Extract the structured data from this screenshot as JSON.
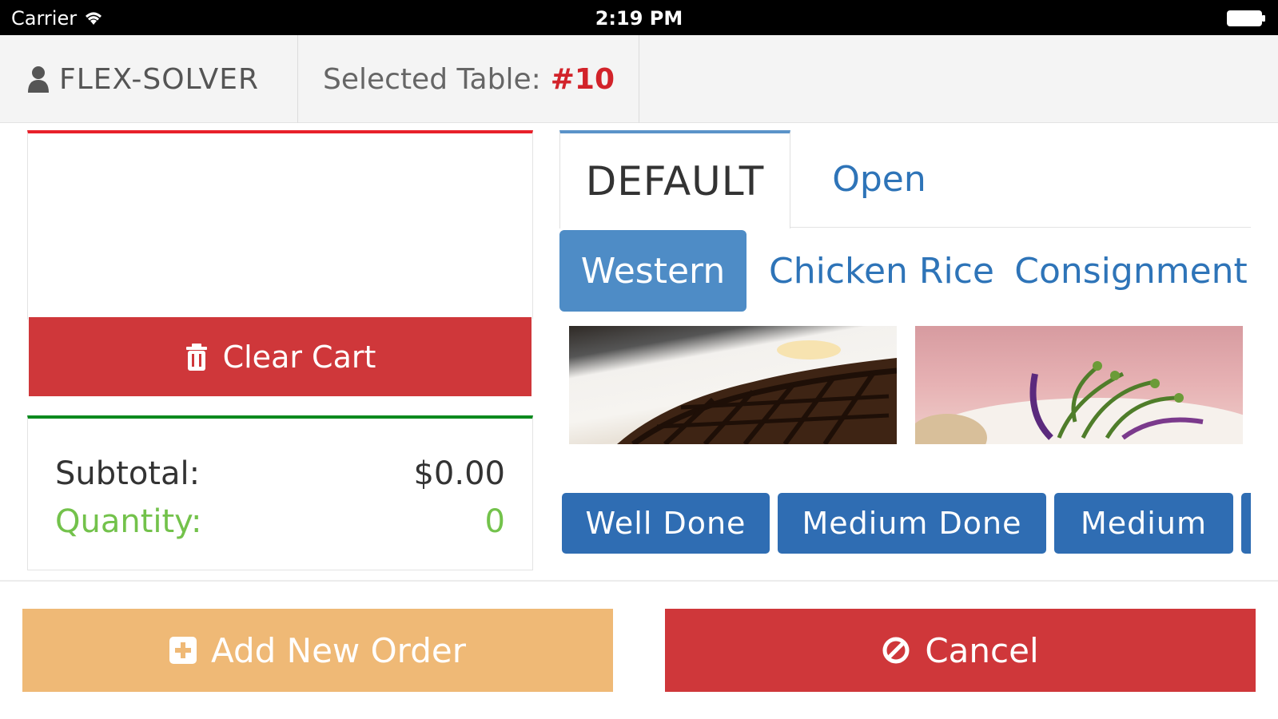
{
  "status_bar": {
    "carrier": "Carrier",
    "time": "2:19 PM"
  },
  "header": {
    "user_name": "FLEX-SOLVER",
    "selected_table_label": "Selected Table:",
    "selected_table_number": "#10"
  },
  "cart": {
    "clear_label": "Clear Cart",
    "subtotal_label": "Subtotal:",
    "subtotal_value": "$0.00",
    "quantity_label": "Quantity:",
    "quantity_value": "0"
  },
  "menu_tabs": [
    {
      "label": "DEFAULT",
      "active": true
    },
    {
      "label": "Open",
      "active": false
    }
  ],
  "categories": [
    {
      "label": "Western",
      "active": true
    },
    {
      "label": "Chicken Rice",
      "active": false
    },
    {
      "label": "Consignment",
      "active": false
    }
  ],
  "items": [
    {
      "icon": "steak-image"
    },
    {
      "icon": "salad-image"
    }
  ],
  "modifiers": [
    {
      "label": "Well Done"
    },
    {
      "label": "Medium Done"
    },
    {
      "label": "Medium"
    }
  ],
  "actions": {
    "add_order_label": "Add New Order",
    "cancel_label": "Cancel"
  },
  "colors": {
    "danger": "#cf373a",
    "primary": "#2f6db3",
    "warning": "#efb976",
    "success": "#73c24b",
    "accent_red": "#d2232a"
  }
}
